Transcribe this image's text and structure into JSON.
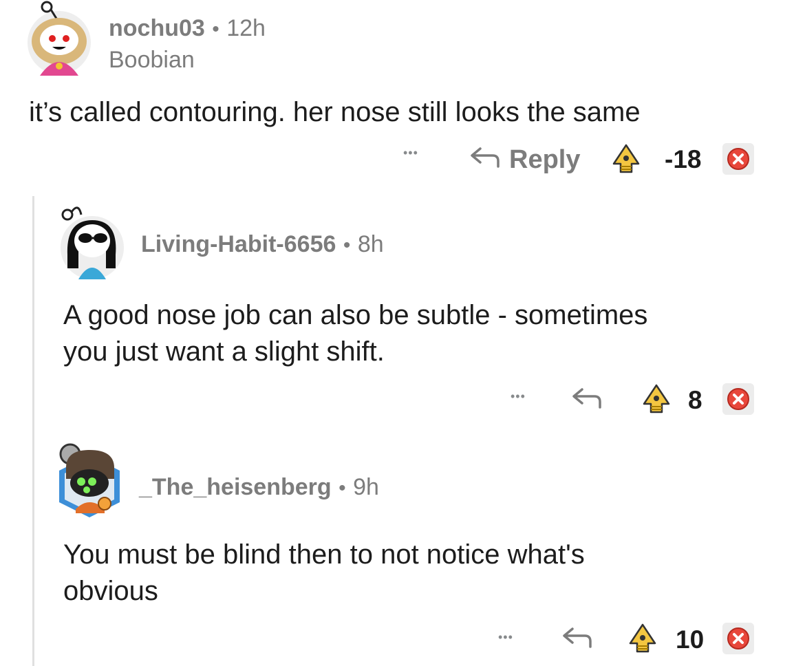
{
  "comments": [
    {
      "username": "nochu03",
      "separator": "•",
      "time": "12h",
      "flair": "Boobian",
      "body_lines": [
        "it’s called contouring. her nose still looks the same"
      ],
      "more": "•••",
      "reply_label": "Reply",
      "votes": "-18"
    },
    {
      "username": "Living-Habit-6656",
      "separator": "•",
      "time": "8h",
      "body_lines": [
        "A good nose job can also be subtle - sometimes",
        "you just want a slight shift."
      ],
      "more": "•••",
      "votes": "8"
    },
    {
      "username": "_The_heisenberg",
      "separator": "•",
      "time": "9h",
      "body_lines": [
        "You must be blind then to not notice what's",
        "obvious"
      ],
      "more": "•••",
      "votes": "10"
    }
  ],
  "icons": {
    "reply": "reply-arrow-icon",
    "upvote": "upvote-award-icon",
    "downvote": "downvote-x-icon"
  },
  "colors": {
    "muted": "#7c7c7c",
    "text": "#1c1c1c",
    "downvote_red": "#e8473b",
    "upvote_gold": "#f3c641"
  }
}
